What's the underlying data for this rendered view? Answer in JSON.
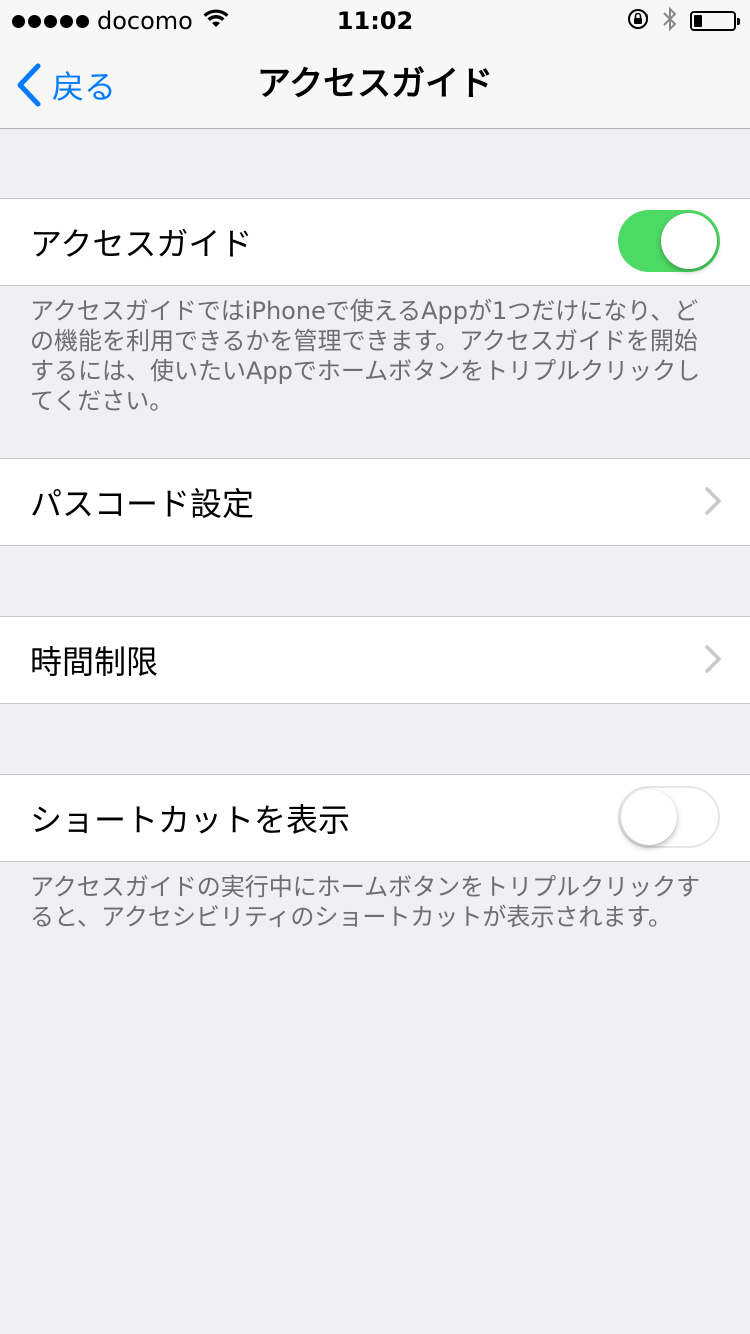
{
  "status_bar": {
    "carrier": "docomo",
    "time": "11:02",
    "battery_level": 0.2
  },
  "nav": {
    "back_label": "戻る",
    "title": "アクセスガイド"
  },
  "guided_access": {
    "label": "アクセスガイド",
    "enabled": true,
    "footer": "アクセスガイドではiPhoneで使えるAppが1つだけになり、どの機能を利用できるかを管理できます。アクセスガイドを開始するには、使いたいAppでホームボタンをトリプルクリックしてください。"
  },
  "passcode_settings": {
    "label": "パスコード設定"
  },
  "time_limits": {
    "label": "時間制限"
  },
  "shortcut": {
    "label": "ショートカットを表示",
    "enabled": false,
    "footer": "アクセスガイドの実行中にホームボタンをトリプルクリックすると、アクセシビリティのショートカットが表示されます。"
  },
  "colors": {
    "accent": "#007aff",
    "toggle_on": "#4cd964",
    "background": "#efeff4"
  }
}
